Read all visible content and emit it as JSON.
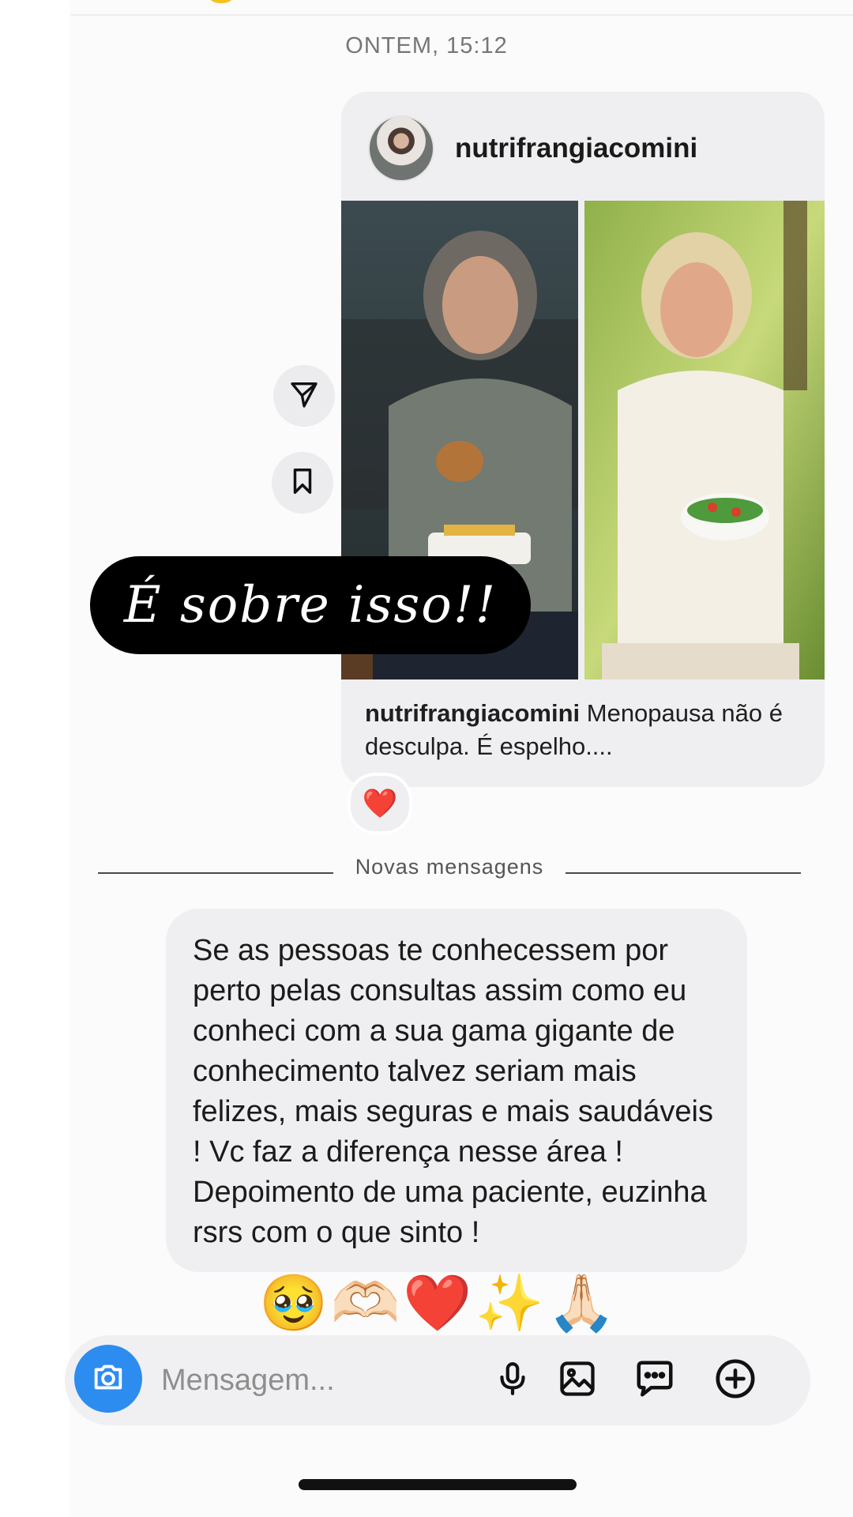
{
  "thread": {
    "timestamp": "ONTEM, 15:12"
  },
  "shared_post": {
    "username": "nutrifrangiacomini",
    "caption_user": "nutrifrangiacomini",
    "caption_text": " Menopausa não é desculpa. É espelho....",
    "reaction": "❤️"
  },
  "sticker": {
    "text": "É sobre isso!!"
  },
  "divider": {
    "label": "Novas mensagens"
  },
  "message": {
    "text": "Se as pessoas te conhecessem por perto pelas consultas assim como eu conheci com a sua gama gigante de conhecimento talvez seriam mais felizes, mais seguras e mais saudáveis ! Vc faz a diferença nesse área ! Depoimento de uma paciente, euzinha rsrs com o que sinto !",
    "emojis": "🥹🫶🏻❤️✨🙏🏻"
  },
  "composer": {
    "placeholder": "Mensagem..."
  },
  "icons": {
    "share": "paper-plane-icon",
    "save": "bookmark-icon",
    "camera": "camera-icon",
    "mic": "microphone-icon",
    "gallery": "image-icon",
    "sticker": "chat-bubble-icon",
    "more": "plus-circle-icon"
  },
  "colors": {
    "accent": "#2d8cf0",
    "bubble": "#efeff1",
    "heart": "#e0202e"
  }
}
